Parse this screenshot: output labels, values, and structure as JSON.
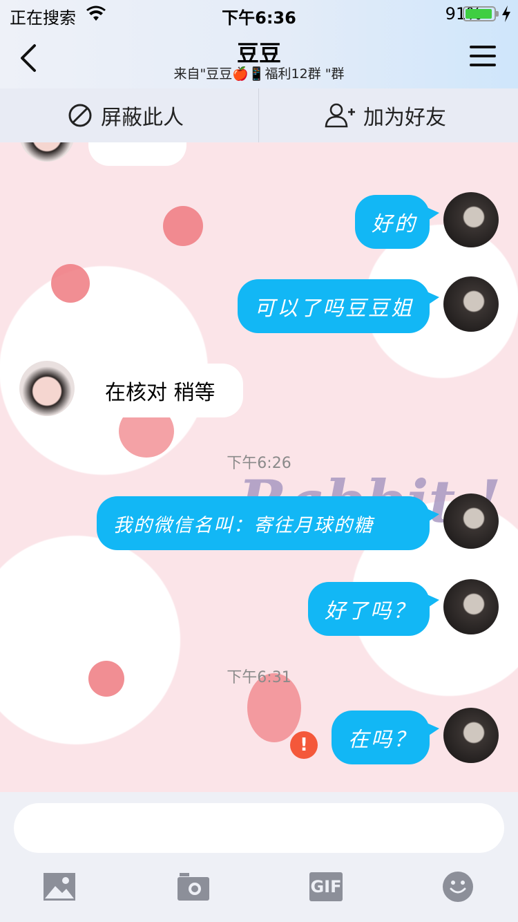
{
  "status": {
    "carrier": "正在搜索",
    "time": "下午6:36",
    "battery_percent": "91%"
  },
  "header": {
    "title": "豆豆",
    "subtitle": "来自\"豆豆🍎📱福利12群 \"群"
  },
  "actions": {
    "block_label": "屏蔽此人",
    "add_friend_label": "加为好友"
  },
  "background": {
    "decor_text": "Rabbit !"
  },
  "messages": [
    {
      "from": "me",
      "text": "好的"
    },
    {
      "from": "me",
      "text": "可以了吗豆豆姐"
    },
    {
      "from": "them",
      "text": "在核对 稍等"
    },
    {
      "type": "timestamp",
      "text": "下午6:26"
    },
    {
      "from": "me",
      "text": "我的微信名叫：寄往月球的糖"
    },
    {
      "from": "me",
      "text": "好了吗？"
    },
    {
      "type": "timestamp",
      "text": "下午6:31"
    },
    {
      "from": "me",
      "text": "在吗？",
      "failed": true
    }
  ],
  "input": {
    "value": "",
    "placeholder": ""
  },
  "toolbar": {
    "gif_label": "GIF"
  },
  "icons": [
    "wifi-icon",
    "battery-icon",
    "back-icon",
    "menu-icon",
    "block-icon",
    "add-friend-icon",
    "image-icon",
    "camera-icon",
    "gif-icon",
    "emoji-icon",
    "error-icon"
  ],
  "colors": {
    "outgoing_bubble": "#12b7f5",
    "incoming_bubble": "#ffffff",
    "error": "#f4583a",
    "battery": "#3fce42"
  }
}
